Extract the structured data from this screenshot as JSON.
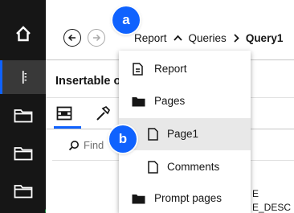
{
  "breadcrumb": {
    "items": [
      "Report",
      "Queries",
      "Query1"
    ],
    "current": "Query1"
  },
  "panel": {
    "title": "Insertable o",
    "find_placeholder": "Find",
    "peek_texts": [
      "E",
      "E_DESC"
    ]
  },
  "menu": {
    "items": [
      {
        "label": "Report",
        "icon": "report-icon"
      },
      {
        "label": "Pages",
        "icon": "folder-icon"
      },
      {
        "label": "Page1",
        "icon": "page-icon",
        "selected": true
      },
      {
        "label": "Comments",
        "icon": "page-icon"
      },
      {
        "label": "Prompt pages",
        "icon": "folder-icon"
      }
    ]
  },
  "callouts": {
    "a": "a",
    "b": "b"
  },
  "colors": {
    "rail": "#161616",
    "accent": "#0f62fe",
    "callout": "#0f62fe",
    "selected_row": "#e8e8e8"
  }
}
